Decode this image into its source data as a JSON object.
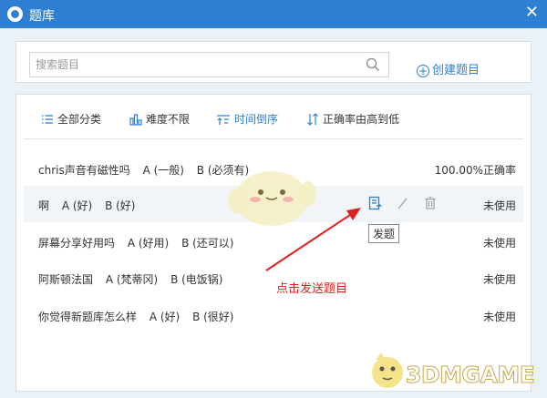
{
  "window": {
    "title": "题库"
  },
  "search": {
    "placeholder": "搜索题目"
  },
  "create_label": "创建题目",
  "filters": [
    {
      "label": "全部分类",
      "icon": "list-icon"
    },
    {
      "label": "难度不限",
      "icon": "bar-chart-icon"
    },
    {
      "label": "时间倒序",
      "icon": "sort-time-icon"
    },
    {
      "label": "正确率由高到低",
      "icon": "sort-arrows-icon"
    }
  ],
  "questions": [
    {
      "text": "chris声音有磁性吗",
      "options": [
        "A (一般)",
        "B (必须有)"
      ],
      "status": "100.00%正确率"
    },
    {
      "text": "啊",
      "options": [
        "A (好)",
        "B (好)"
      ],
      "status": "未使用"
    },
    {
      "text": "屏幕分享好用吗",
      "options": [
        "A (好用)",
        "B (还可以)"
      ],
      "status": "未使用"
    },
    {
      "text": "阿斯顿法国",
      "options": [
        "A (梵蒂冈)",
        "B (电饭锅)"
      ],
      "status": "未使用"
    },
    {
      "text": "你觉得新题库怎么样",
      "options": [
        "A (好)",
        "B (很好)"
      ],
      "status": "未使用"
    }
  ],
  "tooltip": "发题",
  "annotation": "点击发送题目",
  "watermark": "3DMGAME",
  "colors": {
    "titlebar": "#2e7fd1",
    "accent": "#2e7fd1",
    "annotation": "#e02020"
  }
}
